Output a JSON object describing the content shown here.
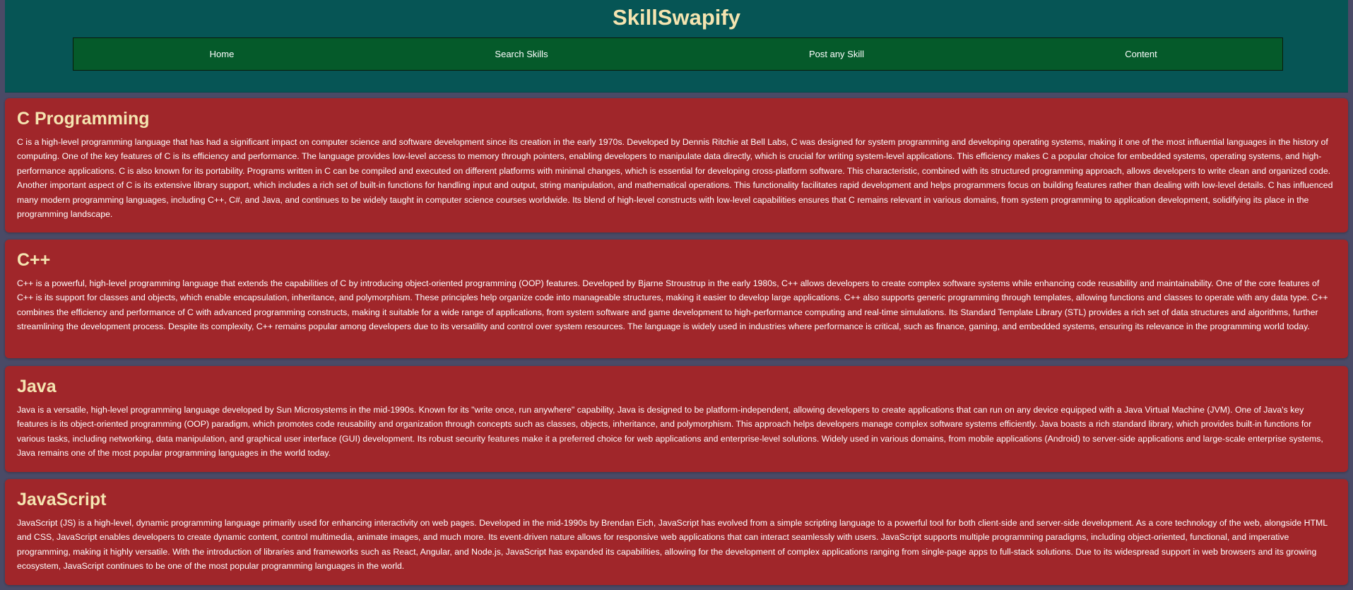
{
  "header": {
    "title": "SkillSwapify"
  },
  "nav": {
    "items": [
      {
        "label": "Home"
      },
      {
        "label": "Search Skills"
      },
      {
        "label": "Post any Skill"
      },
      {
        "label": "Content"
      }
    ]
  },
  "colors": {
    "header_bg": "#065555",
    "nav_bg": "#055a2a",
    "card_bg": "#a0262a",
    "title_text": "#f4e4b0",
    "page_bg": "#4a4a66"
  },
  "sections": [
    {
      "title": "C Programming",
      "body": "C is a high-level programming language that has had a significant impact on computer science and software development since its creation in the early 1970s. Developed by Dennis Ritchie at Bell Labs, C was designed for system programming and developing operating systems, making it one of the most influential languages in the history of computing. One of the key features of C is its efficiency and performance. The language provides low-level access to memory through pointers, enabling developers to manipulate data directly, which is crucial for writing system-level applications. This efficiency makes C a popular choice for embedded systems, operating systems, and high-performance applications. C is also known for its portability. Programs written in C can be compiled and executed on different platforms with minimal changes, which is essential for developing cross-platform software. This characteristic, combined with its structured programming approach, allows developers to write clean and organized code. Another important aspect of C is its extensive library support, which includes a rich set of built-in functions for handling input and output, string manipulation, and mathematical operations. This functionality facilitates rapid development and helps programmers focus on building features rather than dealing with low-level details. C has influenced many modern programming languages, including C++, C#, and Java, and continues to be widely taught in computer science courses worldwide. Its blend of high-level constructs with low-level capabilities ensures that C remains relevant in various domains, from system programming to application development, solidifying its place in the programming landscape."
    },
    {
      "title": "C++",
      "body": "C++ is a powerful, high-level programming language that extends the capabilities of C by introducing object-oriented programming (OOP) features. Developed by Bjarne Stroustrup in the early 1980s, C++ allows developers to create complex software systems while enhancing code reusability and maintainability. One of the core features of C++ is its support for classes and objects, which enable encapsulation, inheritance, and polymorphism. These principles help organize code into manageable structures, making it easier to develop large applications. C++ also supports generic programming through templates, allowing functions and classes to operate with any data type. C++ combines the efficiency and performance of C with advanced programming constructs, making it suitable for a wide range of applications, from system software and game development to high-performance computing and real-time simulations. Its Standard Template Library (STL) provides a rich set of data structures and algorithms, further streamlining the development process. Despite its complexity, C++ remains popular among developers due to its versatility and control over system resources. The language is widely used in industries where performance is critical, such as finance, gaming, and embedded systems, ensuring its relevance in the programming world today."
    },
    {
      "title": "Java",
      "body": "Java is a versatile, high-level programming language developed by Sun Microsystems in the mid-1990s. Known for its \"write once, run anywhere\" capability, Java is designed to be platform-independent, allowing developers to create applications that can run on any device equipped with a Java Virtual Machine (JVM). One of Java's key features is its object-oriented programming (OOP) paradigm, which promotes code reusability and organization through concepts such as classes, objects, inheritance, and polymorphism. This approach helps developers manage complex software systems efficiently. Java boasts a rich standard library, which provides built-in functions for various tasks, including networking, data manipulation, and graphical user interface (GUI) development. Its robust security features make it a preferred choice for web applications and enterprise-level solutions. Widely used in various domains, from mobile applications (Android) to server-side applications and large-scale enterprise systems, Java remains one of the most popular programming languages in the world today."
    },
    {
      "title": "JavaScript",
      "body": "JavaScript (JS) is a high-level, dynamic programming language primarily used for enhancing interactivity on web pages. Developed in the mid-1990s by Brendan Eich, JavaScript has evolved from a simple scripting language to a powerful tool for both client-side and server-side development. As a core technology of the web, alongside HTML and CSS, JavaScript enables developers to create dynamic content, control multimedia, animate images, and much more. Its event-driven nature allows for responsive web applications that can interact seamlessly with users. JavaScript supports multiple programming paradigms, including object-oriented, functional, and imperative programming, making it highly versatile. With the introduction of libraries and frameworks such as React, Angular, and Node.js, JavaScript has expanded its capabilities, allowing for the development of complex applications ranging from single-page apps to full-stack solutions. Due to its widespread support in web browsers and its growing ecosystem, JavaScript continues to be one of the most popular programming languages in the world."
    }
  ]
}
